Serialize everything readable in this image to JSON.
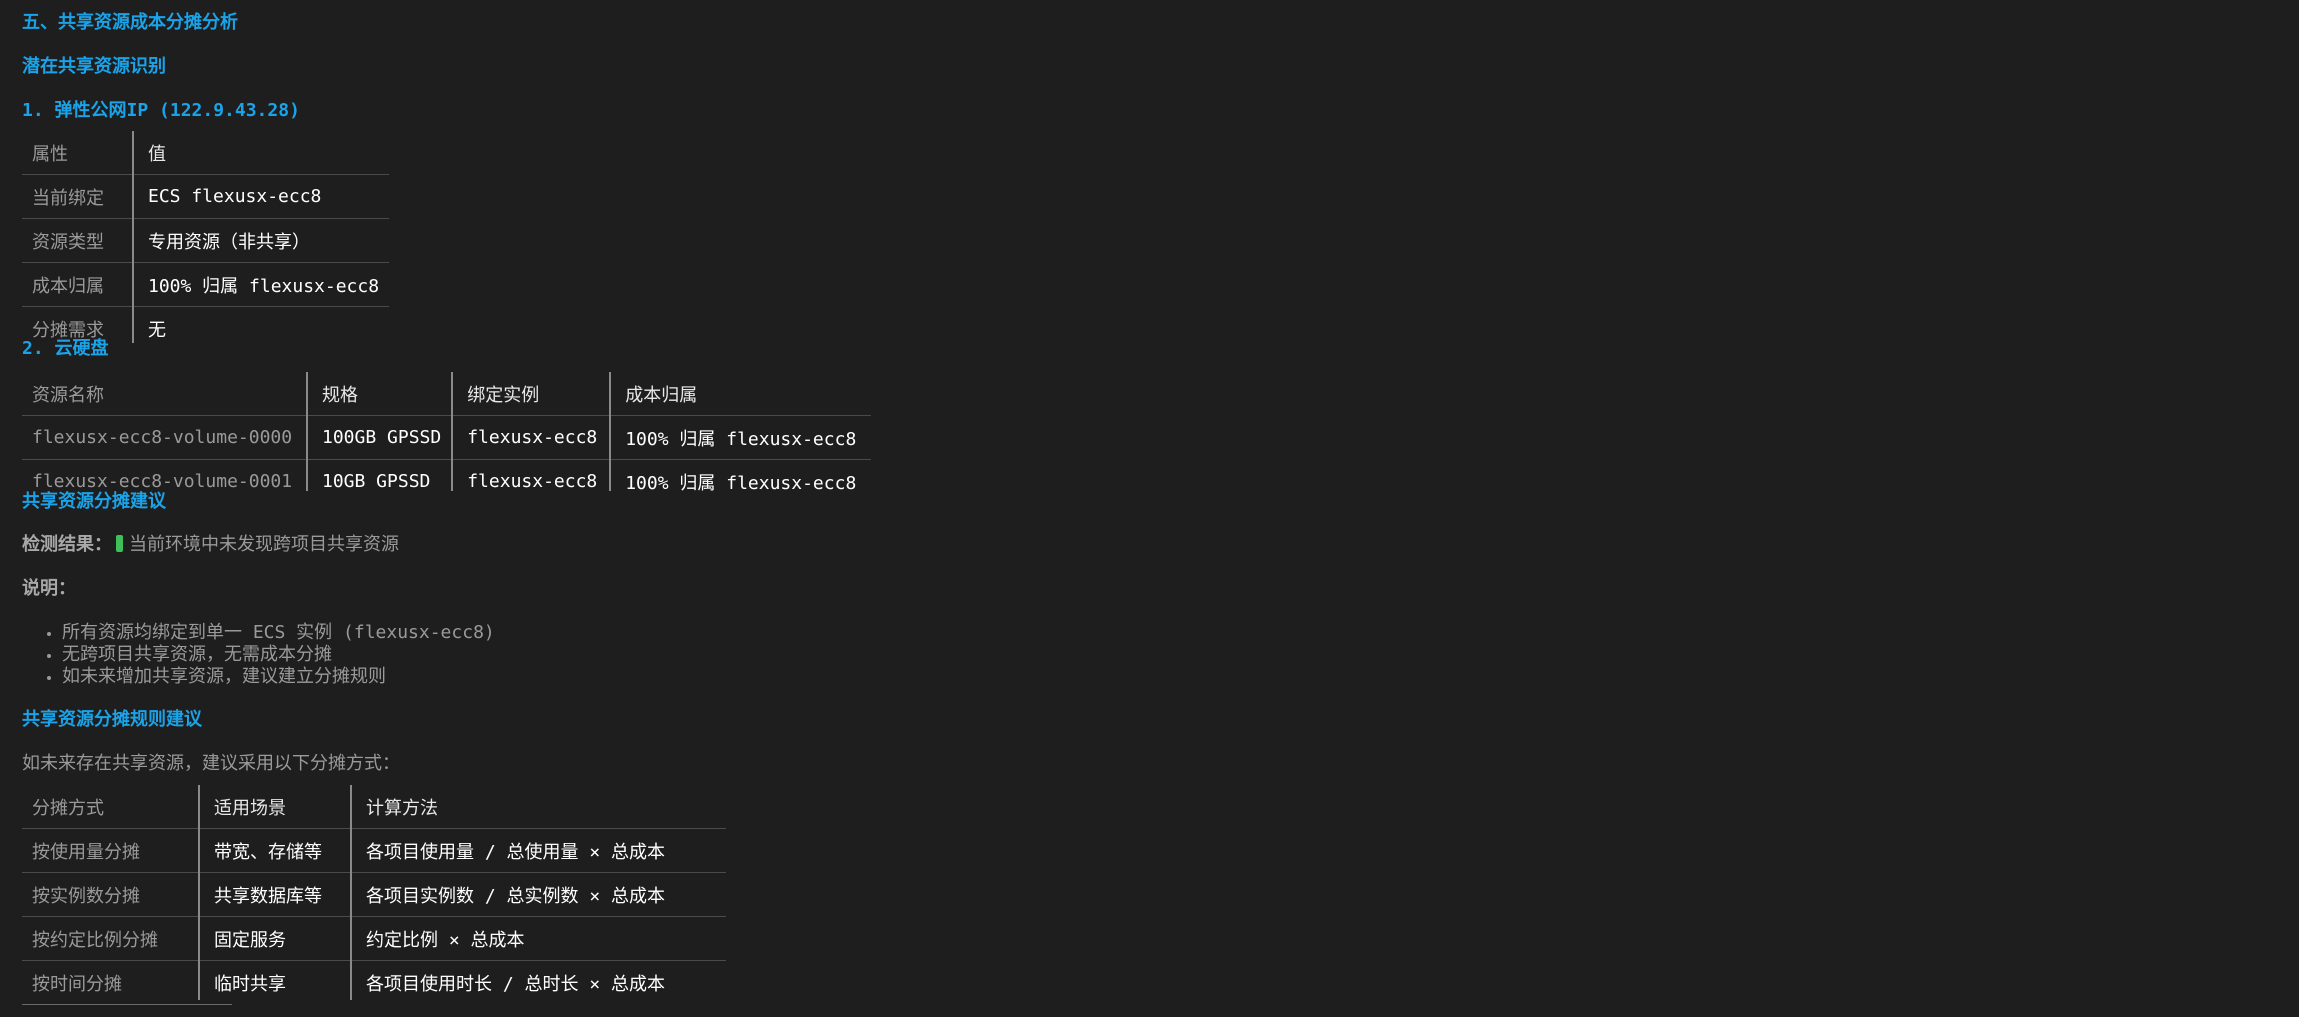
{
  "section_title": "五、共享资源成本分摊分析",
  "sub1": "潜在共享资源识别",
  "eip": {
    "heading": "1. 弹性公网IP (122.9.43.28)",
    "headers": [
      "属性",
      "值"
    ],
    "rows": [
      [
        "当前绑定",
        "ECS flexusx-ecc8"
      ],
      [
        "资源类型",
        "专用资源（非共享）"
      ],
      [
        "成本归属",
        "100% 归属 flexusx-ecc8"
      ],
      [
        "分摊需求",
        "无"
      ]
    ]
  },
  "disk": {
    "heading": "2. 云硬盘",
    "headers": [
      "资源名称",
      "规格",
      "绑定实例",
      "成本归属"
    ],
    "rows": [
      [
        "flexusx-ecc8-volume-0000",
        "100GB GPSSD",
        "flexusx-ecc8",
        "100% 归属 flexusx-ecc8"
      ],
      [
        "flexusx-ecc8-volume-0001",
        "10GB GPSSD",
        "flexusx-ecc8",
        "100% 归属 flexusx-ecc8"
      ]
    ]
  },
  "suggest": {
    "heading": "共享资源分摊建议",
    "detect_label": "检测结果：",
    "detect_text": "当前环境中未发现跨项目共享资源",
    "note_label": "说明：",
    "bullets": [
      "所有资源均绑定到单一 ECS 实例 (flexusx-ecc8)",
      "无跨项目共享资源，无需成本分摊",
      "如未来增加共享资源，建议建立分摊规则"
    ]
  },
  "rules": {
    "heading": "共享资源分摊规则建议",
    "intro": "如未来存在共享资源，建议采用以下分摊方式：",
    "headers": [
      "分摊方式",
      "适用场景",
      "计算方法"
    ],
    "rows": [
      [
        "按使用量分摊",
        "带宽、存储等",
        "各项目使用量 / 总使用量 × 总成本"
      ],
      [
        "按实例数分摊",
        "共享数据库等",
        "各项目实例数 / 总实例数 × 总成本"
      ],
      [
        "按约定比例分摊",
        "固定服务",
        "约定比例 × 总成本"
      ],
      [
        "按时间分摊",
        "临时共享",
        "各项目使用时长 / 总时长 × 总成本"
      ]
    ]
  },
  "colors": {
    "background": "#1e1e1e",
    "heading": "#1aa3e8",
    "check": "#3fbf5a"
  }
}
